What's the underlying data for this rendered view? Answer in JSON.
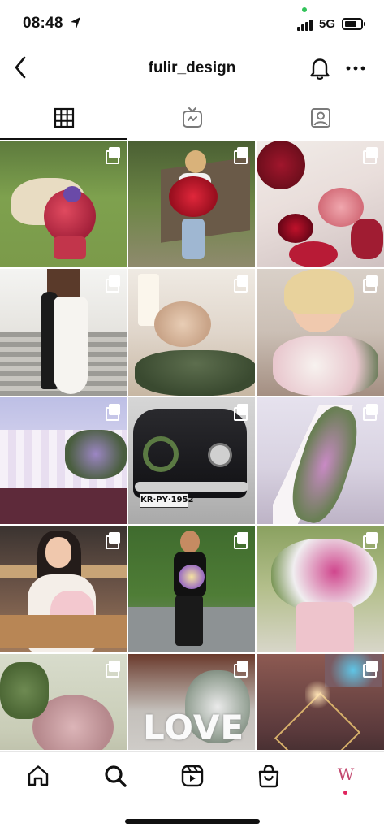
{
  "status": {
    "time": "08:48",
    "network": "5G",
    "battery_level": 0.75
  },
  "header": {
    "title": "fulir_design"
  },
  "tabs": [
    {
      "name": "grid",
      "icon": "grid-icon",
      "active": true
    },
    {
      "name": "reels",
      "icon": "igtv-icon",
      "active": false
    },
    {
      "name": "tagged",
      "icon": "tagged-person-icon",
      "active": false
    }
  ],
  "posts": [
    {
      "icon": "carousel-icon"
    },
    {
      "icon": "carousel-icon"
    },
    {
      "icon": "carousel-icon"
    },
    {
      "icon": "carousel-icon"
    },
    {
      "icon": "carousel-icon"
    },
    {
      "icon": "carousel-icon"
    },
    {
      "icon": "carousel-icon"
    },
    {
      "icon": "carousel-icon"
    },
    {
      "icon": "carousel-icon"
    },
    {
      "icon": "carousel-icon"
    },
    {
      "icon": "carousel-icon"
    },
    {
      "icon": "carousel-icon"
    },
    {
      "icon": "carousel-icon"
    },
    {
      "icon": "carousel-icon"
    },
    {
      "icon": "carousel-icon"
    }
  ],
  "photo_text": {
    "license_plate": "KR·PY·1952",
    "love_sign": "LOVE"
  },
  "bottom_nav": {
    "items": [
      "home-icon",
      "search-icon",
      "reels-icon",
      "shop-icon",
      "profile-avatar"
    ],
    "avatar_letter": "W"
  },
  "colors": {
    "accent_pink": "#c2476e",
    "notification_dot": "#e0245e"
  }
}
